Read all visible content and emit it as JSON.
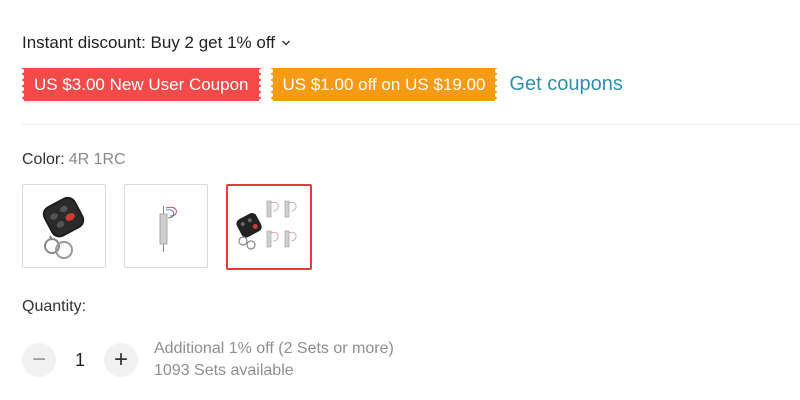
{
  "discount": {
    "label": "Instant discount: Buy 2 get 1% off",
    "chevron_icon": "chevron-down-icon"
  },
  "coupons": {
    "items": [
      {
        "label": "US $3.00 New User Coupon",
        "color": "#f44a4a"
      },
      {
        "label": "US $1.00 off on US $19.00",
        "color": "#f79a14"
      }
    ],
    "get_coupons_label": "Get coupons",
    "link_color": "#2e8fb0"
  },
  "color": {
    "label": "Color:",
    "selected_value": "4R 1RC",
    "options": [
      {
        "name": "black-remote",
        "icon": "remote-control-icon"
      },
      {
        "name": "receiver-module",
        "icon": "receiver-icon"
      },
      {
        "name": "4R 1RC",
        "icon": "bundle-icon",
        "selected": true
      }
    ],
    "selected_border_color": "#e23c3c"
  },
  "quantity": {
    "label": "Quantity:",
    "value": "1",
    "minus_label": "−",
    "plus_label": "+",
    "discount_note": "Additional 1% off (2 Sets or more)",
    "available": "1093 Sets available"
  }
}
